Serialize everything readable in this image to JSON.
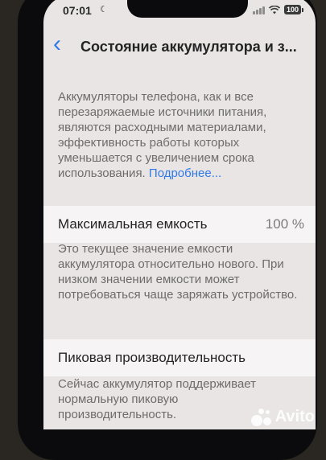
{
  "status_bar": {
    "time": "07:01",
    "battery": "100"
  },
  "nav": {
    "title": "Состояние аккумулятора и з..."
  },
  "intro": {
    "text": "Аккумуляторы телефона, как и все перезаряжаемые источники питания, являются расходными материалами, эффективность работы которых уменьшается с увеличением срока использования. ",
    "link": "Подробнее..."
  },
  "capacity": {
    "label": "Максимальная емкость",
    "value": "100 %",
    "description": "Это текущее значение емкости аккумулятора относительно нового. При низком значении емкости может потребоваться чаще заряжать устройство."
  },
  "peak": {
    "label": "Пиковая производительность",
    "description": "Сейчас аккумулятор поддерживает нормальную пиковую производительность."
  },
  "watermark": {
    "text": "Avito"
  }
}
